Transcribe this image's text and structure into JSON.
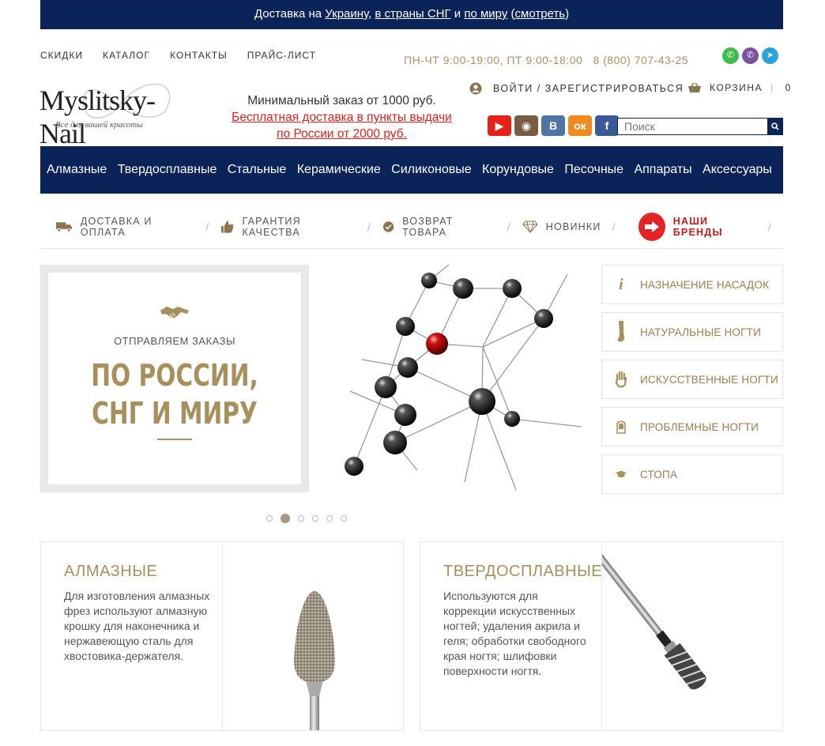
{
  "topbar": {
    "prefix": "Доставка на ",
    "link1": "Украину",
    "sep1": ", ",
    "link2": "в страны СНГ",
    "sep2": " и ",
    "link3": "по миру",
    "sep3": " (",
    "link4": "смотреть",
    "suffix": ")"
  },
  "topnav": [
    "СКИДКИ",
    "КАТАЛОГ",
    "КОНТАКТЫ",
    "ПРАЙС-ЛИСТ"
  ],
  "hours": "ПН-ЧТ 9:00-19:00, ПТ 9:00-18:00",
  "phone": "8 (800) 707-43-25",
  "logo": {
    "name": "Myslitsky-Nail",
    "tagline": "Все для вашей красоты"
  },
  "min_order": {
    "line1": "Минимальный заказ от 1000 руб.",
    "line2": "Бесплатная доставка в пункты выдачи",
    "line3": "по России от 2000 руб."
  },
  "login_label": "ВОЙТИ / ЗАРЕГИСТРИРОВАТЬСЯ",
  "cart": {
    "label": "КОРЗИНА",
    "count": "0"
  },
  "search": {
    "placeholder": "Поиск"
  },
  "categories": [
    "Алмазные",
    "Твердосплавные",
    "Стальные",
    "Керамические",
    "Силиконовые",
    "Корундовые",
    "Песочные",
    "Аппараты",
    "Аксессуары"
  ],
  "features": {
    "delivery": "ДОСТАВКА И ОПЛАТА",
    "quality": "ГАРАНТИЯ КАЧЕСТВА",
    "returns": "ВОЗВРАТ ТОВАРА",
    "new": "НОВИНКИ",
    "brands": "НАШИ БРЕНДЫ"
  },
  "slide": {
    "subtitle": "ОТПРАВЛЯЕМ ЗАКАЗЫ",
    "big_line1": "ПО РОССИИ,",
    "big_line2": "СНГ И МИРУ"
  },
  "slider_dots": {
    "count": 6,
    "active": 1
  },
  "side_menu": [
    {
      "label": "НАЗНАЧЕНИЕ НАСАДОК",
      "icon": "info-icon"
    },
    {
      "label": "НАТУРАЛЬНЫЕ НОГТИ",
      "icon": "foot-icon"
    },
    {
      "label": "ИСКУССТВЕННЫЕ НОГТИ",
      "icon": "hand-icon"
    },
    {
      "label": "ПРОБЛЕМНЫЕ НОГТИ",
      "icon": "nail-icon"
    },
    {
      "label": "СТОПА",
      "icon": "hat-icon"
    }
  ],
  "cards": [
    {
      "title": "АЛМАЗНЫЕ",
      "desc": "Для изготовления алмазных фрез используют алмазную крошку для наконечника и нержавеющую сталь для хвостовика-держателя."
    },
    {
      "title": "ТВЕРДОСПЛАВНЫЕ",
      "desc": "Используются для коррекции искусственных ногтей; удаления акрила и геля; обработки свободного края ногтя; шлифовки поверхности ногтя."
    }
  ],
  "colors": {
    "navy": "#0a2358",
    "gold": "#a8905c",
    "red": "#e0201b"
  }
}
